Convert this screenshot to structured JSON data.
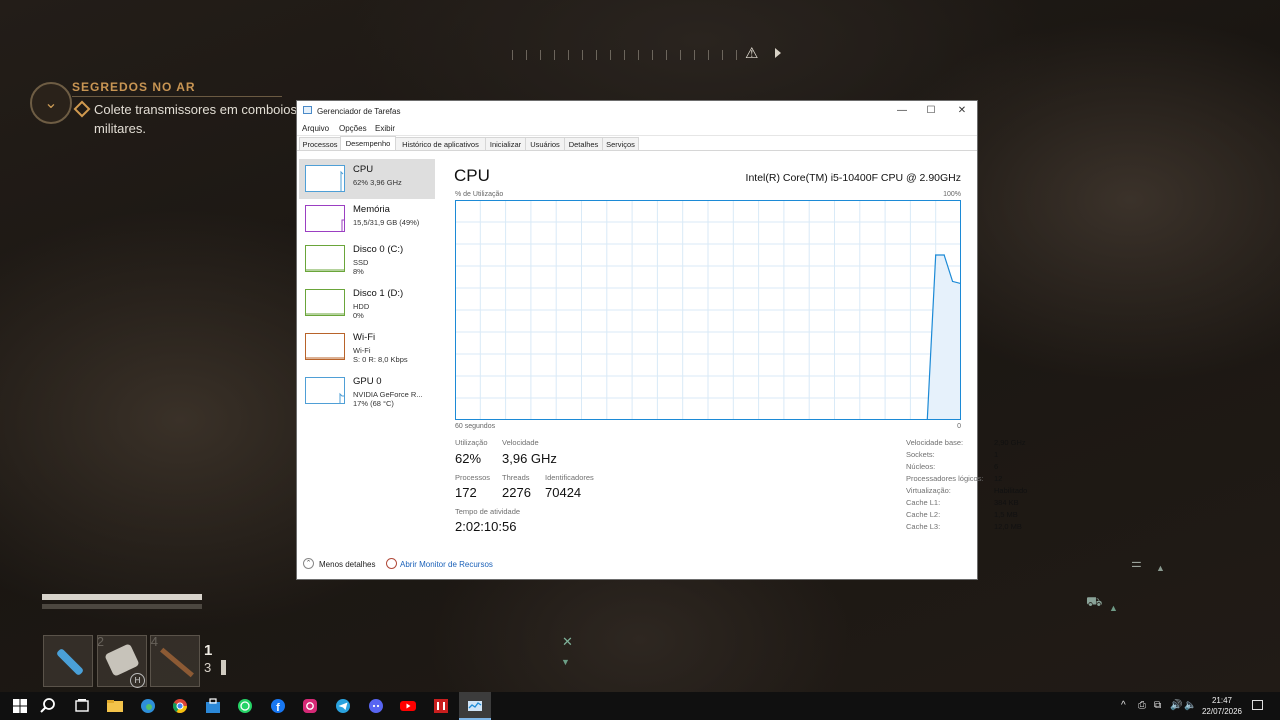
{
  "game_hud": {
    "quest_title": "SEGREDOS NO AR",
    "quest_objective": "Colete transmissores em comboios militares.",
    "slots": [
      {
        "name": "syringe",
        "count": "2"
      },
      {
        "name": "bandage",
        "count": "4"
      },
      {
        "name": "shotgun",
        "count": ""
      }
    ],
    "slot_badge": "H",
    "ammo_loaded": "1",
    "ammo_reserve": "3"
  },
  "window": {
    "title": "Gerenciador de Tarefas",
    "controls": {
      "minimize": "—",
      "maximize": "☐",
      "close": "✕"
    },
    "menu": [
      "Arquivo",
      "Opções",
      "Exibir"
    ],
    "tabs": [
      "Processos",
      "Desempenho",
      "Histórico de aplicativos",
      "Inicializar",
      "Usuários",
      "Detalhes",
      "Serviços"
    ],
    "active_tab": "Desempenho"
  },
  "sidebar": {
    "items": [
      {
        "name": "CPU",
        "line1": "62%  3,96 GHz",
        "line2": "",
        "color": "#4f9fd6",
        "selected": true
      },
      {
        "name": "Memória",
        "line1": "15,5/31,9 GB (49%)",
        "line2": "",
        "color": "#9b3fc2",
        "selected": false
      },
      {
        "name": "Disco 0 (C:)",
        "line1": "SSD",
        "line2": "8%",
        "color": "#6aa53a",
        "selected": false
      },
      {
        "name": "Disco 1 (D:)",
        "line1": "HDD",
        "line2": "0%",
        "color": "#6aa53a",
        "selected": false
      },
      {
        "name": "Wi-Fi",
        "line1": "Wi-Fi",
        "line2": "S: 0  R: 8,0 Kbps",
        "color": "#b8632a",
        "selected": false
      },
      {
        "name": "GPU 0",
        "line1": "NVIDIA GeForce R...",
        "line2": "17%  (68 °C)",
        "color": "#4f9fd6",
        "selected": false
      }
    ]
  },
  "cpu": {
    "title": "CPU",
    "model": "Intel(R) Core(TM) i5-10400F CPU @ 2.90GHz",
    "y_label": "% de Utilização",
    "y_max_label": "100%",
    "x_label": "60 segundos",
    "x_min_label": "0",
    "stats": {
      "utilizacao_label": "Utilização",
      "utilizacao": "62%",
      "velocidade_label": "Velocidade",
      "velocidade": "3,96 GHz",
      "processos_label": "Processos",
      "processos": "172",
      "threads_label": "Threads",
      "threads": "2276",
      "identificadores_label": "Identificadores",
      "identificadores": "70424",
      "tempo_label": "Tempo de atividade",
      "tempo": "2:02:10:56"
    },
    "details": [
      {
        "k": "Velocidade base:",
        "v": "2,90 GHz"
      },
      {
        "k": "Sockets:",
        "v": "1"
      },
      {
        "k": "Núcleos:",
        "v": "6"
      },
      {
        "k": "Processadores lógicos:",
        "v": "12"
      },
      {
        "k": "Virtualização:",
        "v": "Habilitado"
      },
      {
        "k": "Cache L1:",
        "v": "384 KB"
      },
      {
        "k": "Cache L2:",
        "v": "1,5 MB"
      },
      {
        "k": "Cache L3:",
        "v": "12,0 MB"
      }
    ]
  },
  "chart_data": {
    "type": "area",
    "title": "",
    "xlabel": "60 segundos",
    "ylabel": "% de Utilização",
    "xlim": [
      60,
      0
    ],
    "ylim": [
      0,
      100
    ],
    "grid": true,
    "x": [
      60,
      4,
      3,
      2,
      1,
      0
    ],
    "series": [
      {
        "values": [
          0,
          0,
          75,
          75,
          63,
          62
        ]
      }
    ],
    "line_color": "#1c8ad6",
    "fill_color": "#e6f1fb"
  },
  "footer": {
    "less_details": "Menos detalhes",
    "resource_monitor": "Abrir Monitor de Recursos"
  },
  "taskbar": {
    "icons": [
      "windows-start",
      "search",
      "task-view",
      "file-explorer",
      "edge",
      "chrome",
      "store",
      "whatsapp",
      "facebook",
      "instagram",
      "telegram",
      "discord",
      "youtube",
      "game-app",
      "task-manager"
    ],
    "tray": [
      "^",
      "⎙",
      "⧉",
      "🔊",
      "🔈"
    ],
    "time": "21:47",
    "date": "22/07/2026"
  }
}
